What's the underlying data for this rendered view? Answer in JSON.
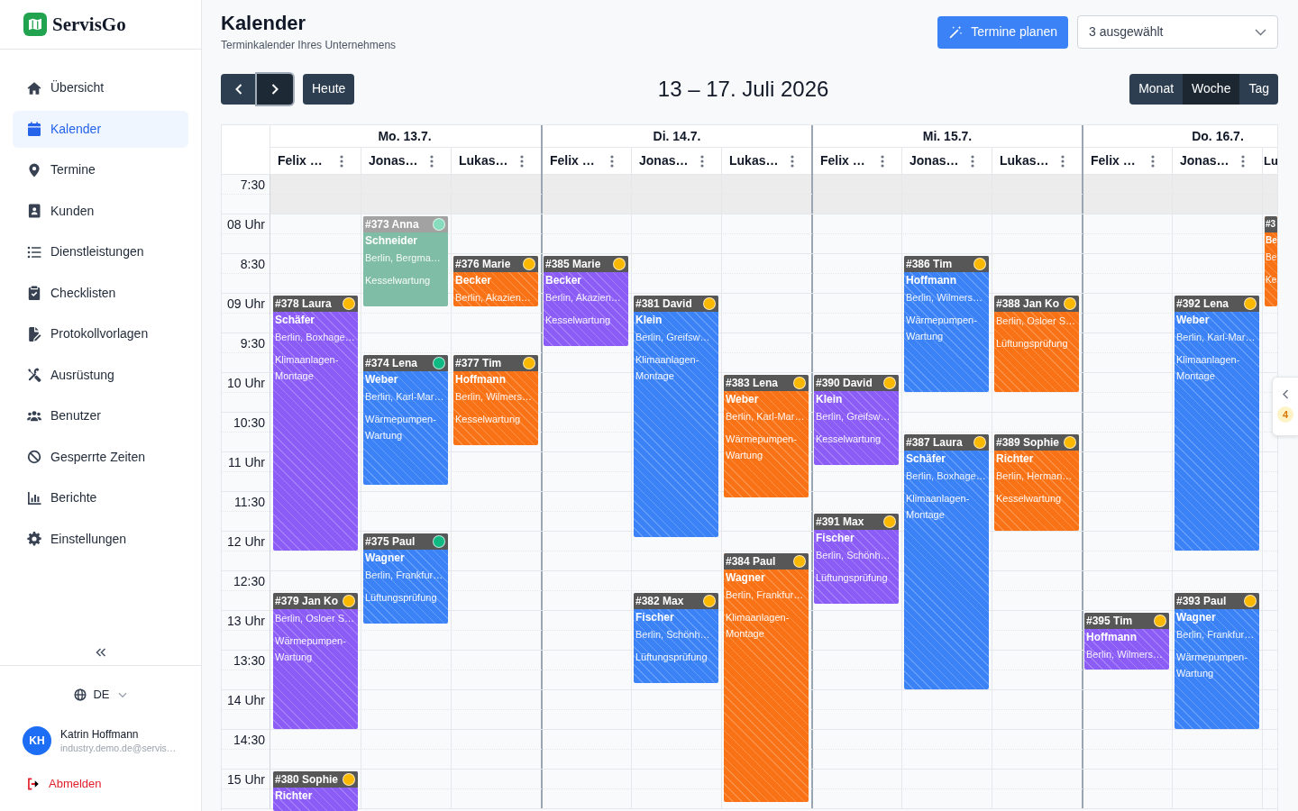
{
  "sidebar": {
    "brand": "ServisGo",
    "nav": [
      {
        "label": "Übersicht",
        "selected": false
      },
      {
        "label": "Kalender",
        "selected": true
      },
      {
        "label": "Termine",
        "selected": false
      },
      {
        "label": "Kunden",
        "selected": false
      },
      {
        "label": "Dienstleistungen",
        "selected": false
      },
      {
        "label": "Checklisten",
        "selected": false
      },
      {
        "label": "Protokollvorlagen",
        "selected": false
      },
      {
        "label": "Ausrüstung",
        "selected": false
      },
      {
        "label": "Benutzer",
        "selected": false
      },
      {
        "label": "Gesperrte Zeiten",
        "selected": false
      },
      {
        "label": "Berichte",
        "selected": false
      },
      {
        "label": "Einstellungen",
        "selected": false
      }
    ],
    "language": "DE",
    "user": {
      "initials": "KH",
      "name": "Katrin Hoffmann",
      "email": "industry.demo.de@servis…"
    },
    "logout": "Abmelden"
  },
  "header": {
    "title": "Kalender",
    "subtitle": "Terminkalender Ihres Unternehmens",
    "plan_button": "Termine planen",
    "resource_select": {
      "value": "3 ausgewählt"
    }
  },
  "toolbar": {
    "nav_buttons": [
      {
        "kind": "prev",
        "focused": false
      },
      {
        "kind": "next",
        "focused": true
      }
    ],
    "today_button": "Heute",
    "range_title": "13 – 17. Juli 2026",
    "views": [
      {
        "label": "Monat",
        "selected": false
      },
      {
        "label": "Woche",
        "selected": true
      },
      {
        "label": "Tag",
        "selected": false
      }
    ]
  },
  "calendar": {
    "time_slots": [
      {
        "label": "7:30",
        "disabled": true
      },
      {
        "label": "08 Uhr",
        "disabled": false
      },
      {
        "label": "8:30",
        "disabled": false
      },
      {
        "label": "09 Uhr",
        "disabled": false
      },
      {
        "label": "9:30",
        "disabled": false
      },
      {
        "label": "10 Uhr",
        "disabled": false
      },
      {
        "label": "10:30",
        "disabled": false
      },
      {
        "label": "11 Uhr",
        "disabled": false
      },
      {
        "label": "11:30",
        "disabled": false
      },
      {
        "label": "12 Uhr",
        "disabled": false
      },
      {
        "label": "12:30",
        "disabled": false
      },
      {
        "label": "13 Uhr",
        "disabled": false
      },
      {
        "label": "13:30",
        "disabled": false
      },
      {
        "label": "14 Uhr",
        "disabled": false
      },
      {
        "label": "14:30",
        "disabled": false
      },
      {
        "label": "15 Uhr",
        "disabled": false
      }
    ],
    "days": [
      {
        "label": "Mo. 13.7.",
        "resources": [
          {
            "name": "Felix …",
            "events": [
              {
                "title": "#378 Laura Schäfer",
                "address": "Berlin, Boxhage…",
                "service": "Klimaanlagen-Montage",
                "color": "#8b5cf6",
                "status": {
                  "color": "#fbb800"
                },
                "faded": false,
                "hatched": true
              },
              {
                "title": "#379 Jan Ko",
                "address": "Berlin, Osloer S…",
                "service": "Wärmepumpen-Wartung",
                "color": "#8b5cf6",
                "status": {
                  "color": "#fbb800"
                },
                "faded": false,
                "hatched": true
              },
              {
                "title": "#380 Sophie Richter",
                "color": "#8b5cf6",
                "status": {
                  "color": "#fbb800"
                },
                "faded": false,
                "hatched": true
              }
            ]
          },
          {
            "name": "Jonas…",
            "events": [
              {
                "title": "#373 Anna Schneider",
                "address": "Berlin, Bergma…",
                "service": "Kesselwartung",
                "color": "#7fbda6",
                "status": {
                  "color": "#86dcbc"
                },
                "faded": true,
                "hatched": false
              },
              {
                "title": "#374 Lena Weber",
                "address": "Berlin, Karl-Mar…",
                "service": "Wärmepumpen-Wartung",
                "color": "#3b82f6",
                "status": {
                  "color": "#10b981"
                },
                "faded": false,
                "hatched": true
              },
              {
                "title": "#375 Paul Wagner",
                "address": "Berlin, Frankfur…",
                "service": "Lüftungsprüfung",
                "color": "#3b82f6",
                "status": {
                  "color": "#10b981"
                },
                "faded": false,
                "hatched": true
              }
            ]
          },
          {
            "name": "Lukas…",
            "events": [
              {
                "title": "#376 Marie Becker",
                "address": "Berlin, Akazien…",
                "color": "#f97316",
                "status": {
                  "color": "#fbb800"
                },
                "faded": false,
                "hatched": true
              },
              {
                "title": "#377 Tim Hoffmann",
                "address": "Berlin, Wilmers…",
                "service": "Kesselwartung",
                "color": "#f97316",
                "status": {
                  "color": "#fbb800"
                },
                "faded": false,
                "hatched": true
              }
            ]
          }
        ]
      },
      {
        "label": "Di. 14.7.",
        "resources": [
          {
            "name": "Felix …",
            "events": [
              {
                "title": "#385 Marie Becker",
                "address": "Berlin, Akazien…",
                "service": "Kesselwartung",
                "color": "#8b5cf6",
                "status": {
                  "color": "#fbb800"
                },
                "faded": false,
                "hatched": true
              }
            ]
          },
          {
            "name": "Jonas…",
            "events": [
              {
                "title": "#381 David Klein",
                "address": "Berlin, Greifsw…",
                "service": "Klimaanlagen-Montage",
                "color": "#3b82f6",
                "status": {
                  "color": "#fbb800"
                },
                "faded": false,
                "hatched": true
              },
              {
                "title": "#382 Max Fischer",
                "address": "Berlin, Schönh…",
                "service": "Lüftungsprüfung",
                "color": "#3b82f6",
                "status": {
                  "color": "#fbb800"
                },
                "faded": false,
                "hatched": true
              }
            ]
          },
          {
            "name": "Lukas…",
            "events": [
              {
                "title": "#383 Lena Weber",
                "address": "Berlin, Karl-Mar…",
                "service": "Wärmepumpen-Wartung",
                "color": "#f97316",
                "status": {
                  "color": "#fbb800"
                },
                "faded": false,
                "hatched": true
              },
              {
                "title": "#384 Paul Wagner",
                "address": "Berlin, Frankfur…",
                "service": "Klimaanlagen-Montage",
                "color": "#f97316",
                "status": {
                  "color": "#fbb800"
                },
                "faded": false,
                "hatched": true
              }
            ]
          }
        ]
      },
      {
        "label": "Mi. 15.7.",
        "resources": [
          {
            "name": "Felix …",
            "events": [
              {
                "title": "#390 David Klein",
                "address": "Berlin, Greifsw…",
                "service": "Kesselwartung",
                "color": "#8b5cf6",
                "status": {
                  "color": "#fbb800"
                },
                "faded": false,
                "hatched": true
              },
              {
                "title": "#391 Max Fischer",
                "address": "Berlin, Schönh…",
                "service": "Lüftungsprüfung",
                "color": "#8b5cf6",
                "status": {
                  "color": "#fbb800"
                },
                "faded": false,
                "hatched": true
              }
            ]
          },
          {
            "name": "Jonas…",
            "events": [
              {
                "title": "#386 Tim Hoffmann",
                "address": "Berlin, Wilmers…",
                "service": "Wärmepumpen-Wartung",
                "color": "#3b82f6",
                "status": {
                  "color": "#fbb800"
                },
                "faded": false,
                "hatched": true
              },
              {
                "title": "#387 Laura Schäfer",
                "address": "Berlin, Boxhage…",
                "service": "Klimaanlagen-Montage",
                "color": "#3b82f6",
                "status": {
                  "color": "#fbb800"
                },
                "faded": false,
                "hatched": true
              }
            ]
          },
          {
            "name": "Lukas…",
            "events": [
              {
                "title": "#388 Jan Ko",
                "address": "Berlin, Osloer S…",
                "service": "Lüftungsprüfung",
                "color": "#f97316",
                "status": {
                  "color": "#fbb800"
                },
                "faded": false,
                "hatched": true
              },
              {
                "title": "#389 Sophie Richter",
                "address": "Berlin, Herman…",
                "service": "Kesselwartung",
                "color": "#f97316",
                "status": {
                  "color": "#fbb800"
                },
                "faded": false,
                "hatched": true
              }
            ]
          }
        ]
      },
      {
        "label": "Do. 16.7.",
        "resources": [
          {
            "name": "Felix …",
            "events": [
              {
                "title": "#395 Tim Hoffmann",
                "address": "Berlin, Wilmers…",
                "color": "#8b5cf6",
                "status": {
                  "color": "#fbb800"
                },
                "faded": false,
                "hatched": true
              }
            ]
          },
          {
            "name": "Jonas…",
            "events": [
              {
                "title": "#392 Lena Weber",
                "address": "Berlin, Karl-Mar…",
                "service": "Klimaanlagen-Montage",
                "color": "#3b82f6",
                "status": {
                  "color": "#fbb800"
                },
                "faded": false,
                "hatched": true
              },
              {
                "title": "#393 Paul Wagner",
                "address": "Berlin, Frankfur…",
                "service": "Wärmepumpen-Wartung",
                "color": "#3b82f6",
                "status": {
                  "color": "#fbb800"
                },
                "faded": false,
                "hatched": true
              }
            ]
          },
          {
            "name": "Lu",
            "events": [
              {
                "title": "#3 Be",
                "address": "Be",
                "service": "Ke",
                "color": "#f97316",
                "faded": false,
                "hatched": true
              }
            ]
          }
        ]
      }
    ]
  },
  "side_panel": {
    "badge": "4"
  }
}
